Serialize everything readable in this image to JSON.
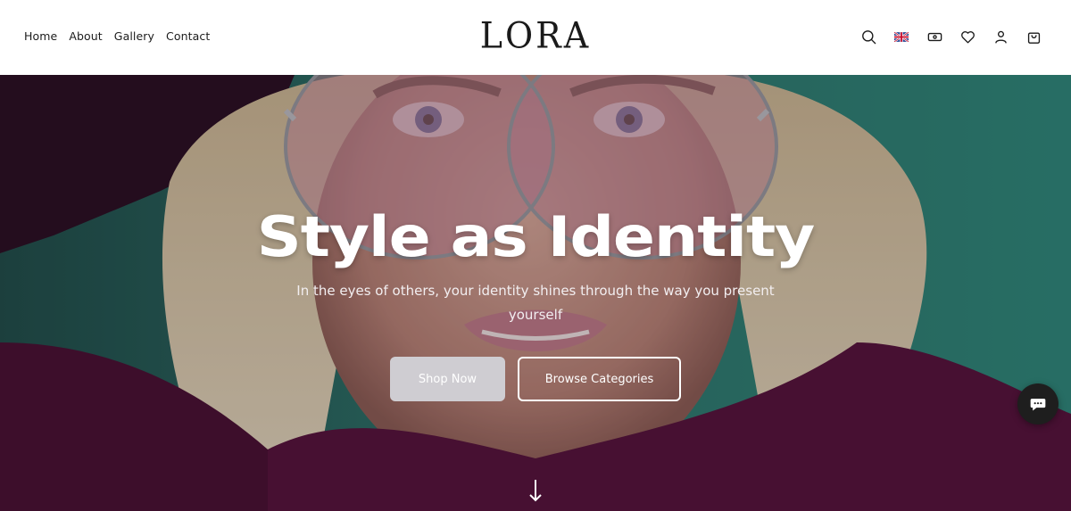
{
  "nav": {
    "items": [
      {
        "label": "Home"
      },
      {
        "label": "About"
      },
      {
        "label": "Gallery"
      },
      {
        "label": "Contact"
      }
    ]
  },
  "brand": {
    "logo_text": "LORA"
  },
  "header_icons": [
    "search-icon",
    "uk-flag-icon",
    "currency-icon",
    "heart-icon",
    "user-icon",
    "shopping-bag-icon"
  ],
  "hero": {
    "headline": "Style as Identity",
    "subtitle": "In the eyes of others, your identity shines through the way you present yourself",
    "primary_button": "Shop Now",
    "secondary_button": "Browse Categories",
    "scroll_icon": "arrow-down-icon"
  },
  "chat": {
    "icon": "chat-bubble-icon"
  },
  "colors": {
    "header_bg": "#ffffff",
    "text_dark": "#1a1a1a",
    "hero_teal": "#2a6f66",
    "sweater_plum": "#4a1033",
    "lens_pink": "#c98a9d",
    "hair_blonde": "#d8c7a6",
    "shop_button_bg": "#cfcdd2",
    "chat_bg": "#1e1e1e"
  }
}
